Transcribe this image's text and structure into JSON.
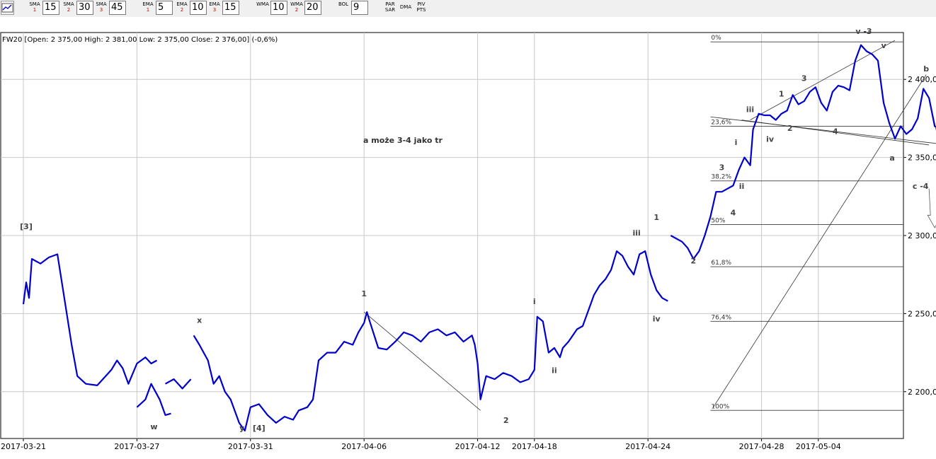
{
  "toolbar": {
    "indicators": [
      {
        "name": "SMA",
        "num": "1",
        "value": "15"
      },
      {
        "name": "SMA",
        "num": "2",
        "value": "30"
      },
      {
        "name": "SMA",
        "num": "3",
        "value": "45"
      },
      {
        "name": "EMA",
        "num": "1",
        "value": "5"
      },
      {
        "name": "EMA",
        "num": "2",
        "value": "10"
      },
      {
        "name": "EMA",
        "num": "3",
        "value": "15"
      },
      {
        "name": "WMA",
        "num": "",
        "value": "10"
      },
      {
        "name": "WMA",
        "num": "2",
        "value": "20"
      },
      {
        "name": "BOL",
        "num": "",
        "value": "9"
      }
    ],
    "buttons": [
      "PAR\nSAR",
      "DMA",
      "PIV\nPTS"
    ]
  },
  "chart_info": "FW20 [Open: 2 375,00  High: 2 381,00  Low: 2 375,00  Close: 2 376,00] (-0,6%)",
  "annotation_text": "a może 3-4  jako tr",
  "colors": {
    "price": "#0000cc",
    "grid": "#c8c8c8",
    "lines": "#000000"
  },
  "chart_data": {
    "type": "line",
    "ylim": [
      2170,
      2430
    ],
    "y_ticks": [
      "2 200,0",
      "2 250,0",
      "2 300,0",
      "2 350,0",
      "2 400,0"
    ],
    "y_tick_values": [
      2200,
      2250,
      2300,
      2350,
      2400
    ],
    "x_ticks": [
      "2017-03-21",
      "2017-03-27",
      "2017-03-31",
      "2017-04-06",
      "2017-04-12",
      "2017-04-18",
      "2017-04-24",
      "2017-04-28",
      "2017-05-04"
    ],
    "x_tick_index": [
      0,
      4,
      8,
      12,
      16,
      18,
      22,
      26,
      28
    ],
    "x_count": 31,
    "series": [
      {
        "values": [
          [
            0,
            2256
          ],
          [
            0.1,
            2270
          ],
          [
            0.2,
            2260
          ],
          [
            0.3,
            2285
          ],
          [
            0.6,
            2282
          ],
          [
            0.9,
            2286
          ],
          [
            1.2,
            2288
          ],
          [
            1.4,
            2265
          ],
          [
            1.7,
            2230
          ],
          [
            1.9,
            2210
          ],
          [
            2.2,
            2205
          ],
          [
            2.6,
            2204
          ],
          [
            2.9,
            2210
          ],
          [
            3.1,
            2214
          ],
          [
            3.3,
            2220
          ],
          [
            3.5,
            2215
          ],
          [
            3.7,
            2205
          ],
          [
            4.0,
            2218
          ],
          [
            4.3,
            2222
          ],
          [
            4.5,
            2218
          ],
          [
            4.7,
            2220
          ],
          null,
          [
            4.0,
            2190
          ],
          [
            4.3,
            2195
          ],
          [
            4.5,
            2205
          ],
          [
            4.8,
            2195
          ],
          [
            5.0,
            2185
          ],
          [
            5.2,
            2186
          ],
          null,
          [
            5.0,
            2205
          ],
          [
            5.3,
            2208
          ],
          [
            5.6,
            2202
          ],
          [
            5.9,
            2208
          ],
          null,
          [
            6.0,
            2236
          ],
          [
            6.2,
            2230
          ],
          [
            6.5,
            2220
          ],
          [
            6.7,
            2205
          ],
          [
            6.9,
            2210
          ],
          [
            7.1,
            2200
          ],
          [
            7.3,
            2195
          ],
          [
            7.5,
            2185
          ],
          [
            7.6,
            2180
          ],
          [
            7.8,
            2175
          ],
          [
            8.0,
            2190
          ],
          [
            8.3,
            2192
          ],
          [
            8.6,
            2185
          ],
          [
            8.9,
            2180
          ],
          [
            9.2,
            2184
          ],
          [
            9.5,
            2182
          ],
          [
            9.7,
            2188
          ],
          [
            10.0,
            2190
          ],
          [
            10.2,
            2195
          ],
          [
            10.4,
            2220
          ],
          [
            10.7,
            2225
          ],
          [
            11.0,
            2225
          ],
          [
            11.3,
            2232
          ],
          [
            11.6,
            2230
          ],
          [
            11.8,
            2238
          ],
          [
            12.0,
            2244
          ],
          [
            12.1,
            2251
          ],
          [
            12.2,
            2245
          ],
          [
            12.5,
            2228
          ],
          [
            12.8,
            2227
          ],
          [
            13.1,
            2232
          ],
          [
            13.4,
            2238
          ],
          [
            13.7,
            2236
          ],
          [
            14.0,
            2232
          ],
          [
            14.3,
            2238
          ],
          [
            14.6,
            2240
          ],
          [
            14.9,
            2236
          ],
          [
            15.2,
            2238
          ],
          [
            15.5,
            2232
          ],
          [
            15.8,
            2236
          ],
          [
            15.9,
            2230
          ],
          [
            16.0,
            2218
          ],
          [
            16.1,
            2195
          ],
          [
            16.3,
            2210
          ],
          [
            16.6,
            2208
          ],
          [
            16.9,
            2212
          ],
          [
            17.2,
            2210
          ],
          [
            17.5,
            2206
          ],
          [
            17.8,
            2208
          ],
          [
            18.0,
            2214
          ],
          [
            18.1,
            2248
          ],
          [
            18.3,
            2245
          ],
          [
            18.5,
            2225
          ],
          [
            18.7,
            2228
          ],
          [
            18.9,
            2222
          ],
          [
            19.0,
            2228
          ],
          [
            19.2,
            2232
          ],
          [
            19.5,
            2240
          ],
          [
            19.7,
            2242
          ],
          [
            19.9,
            2252
          ],
          [
            20.1,
            2262
          ],
          [
            20.3,
            2268
          ],
          [
            20.5,
            2272
          ],
          [
            20.7,
            2278
          ],
          [
            20.9,
            2290
          ],
          [
            21.1,
            2287
          ],
          [
            21.3,
            2280
          ],
          [
            21.5,
            2275
          ],
          [
            21.7,
            2288
          ],
          [
            21.9,
            2290
          ],
          [
            22.1,
            2275
          ],
          [
            22.3,
            2265
          ],
          [
            22.5,
            2260
          ],
          [
            22.7,
            2258
          ],
          null,
          [
            22.8,
            2300
          ],
          [
            23.0,
            2298
          ],
          [
            23.2,
            2296
          ],
          [
            23.4,
            2292
          ],
          [
            23.6,
            2285
          ],
          [
            23.8,
            2290
          ],
          [
            24.0,
            2300
          ],
          [
            24.2,
            2312
          ],
          [
            24.4,
            2328
          ],
          [
            24.6,
            2328
          ],
          [
            24.8,
            2330
          ],
          [
            25.0,
            2332
          ],
          [
            25.2,
            2342
          ],
          [
            25.4,
            2350
          ],
          [
            25.6,
            2345
          ],
          [
            25.7,
            2368
          ],
          [
            25.9,
            2378
          ],
          [
            26.1,
            2377
          ],
          [
            26.3,
            2377
          ],
          [
            26.5,
            2374
          ],
          [
            26.7,
            2378
          ],
          [
            26.9,
            2380
          ],
          [
            27.1,
            2390
          ],
          [
            27.3,
            2384
          ],
          [
            27.5,
            2386
          ],
          [
            27.7,
            2392
          ],
          [
            27.9,
            2395
          ],
          [
            28.1,
            2385
          ],
          [
            28.3,
            2380
          ],
          [
            28.5,
            2392
          ],
          [
            28.7,
            2396
          ],
          [
            28.9,
            2395
          ],
          [
            29.1,
            2393
          ],
          [
            29.3,
            2412
          ],
          [
            29.5,
            2422
          ],
          [
            29.7,
            2418
          ],
          [
            29.9,
            2416
          ],
          [
            30.1,
            2412
          ],
          [
            30.3,
            2385
          ],
          [
            30.5,
            2372
          ],
          [
            30.7,
            2362
          ],
          [
            30.9,
            2370
          ],
          [
            31.1,
            2365
          ],
          [
            31.3,
            2368
          ],
          [
            31.5,
            2375
          ],
          [
            31.7,
            2394
          ],
          [
            31.9,
            2388
          ],
          [
            32.1,
            2370
          ],
          [
            32.3,
            2368
          ]
        ]
      }
    ]
  },
  "fib_levels": [
    {
      "label": "0%",
      "value": 2424
    },
    {
      "label": "23,6%",
      "value": 2370
    },
    {
      "label": "38,2%",
      "value": 2335
    },
    {
      "label": "50%",
      "value": 2307
    },
    {
      "label": "61,8%",
      "value": 2280
    },
    {
      "label": "76,4%",
      "value": 2245
    },
    {
      "label": "100%",
      "value": 2188
    }
  ],
  "wave_labels": [
    {
      "text": "[3]",
      "x": 0.1,
      "y": 2304
    },
    {
      "text": "w",
      "x": 4.6,
      "y": 2176
    },
    {
      "text": "x",
      "x": 6.2,
      "y": 2244
    },
    {
      "text": "y",
      "x": 7.7,
      "y": 2175
    },
    {
      "text": "[4]",
      "x": 8.3,
      "y": 2175
    },
    {
      "text": "1",
      "x": 12.0,
      "y": 2261
    },
    {
      "text": "2",
      "x": 17.0,
      "y": 2180
    },
    {
      "text": "i",
      "x": 18.0,
      "y": 2256
    },
    {
      "text": "ii",
      "x": 18.7,
      "y": 2212
    },
    {
      "text": "iii",
      "x": 21.6,
      "y": 2300
    },
    {
      "text": "iv",
      "x": 22.3,
      "y": 2245
    },
    {
      "text": "1",
      "x": 22.3,
      "y": 2310
    },
    {
      "text": "2",
      "x": 23.6,
      "y": 2282
    },
    {
      "text": "3",
      "x": 24.6,
      "y": 2342
    },
    {
      "text": "4",
      "x": 25.0,
      "y": 2313
    },
    {
      "text": "i",
      "x": 25.1,
      "y": 2358
    },
    {
      "text": "ii",
      "x": 25.3,
      "y": 2330
    },
    {
      "text": "iii",
      "x": 25.6,
      "y": 2379
    },
    {
      "text": "iv",
      "x": 26.3,
      "y": 2360
    },
    {
      "text": "1",
      "x": 26.7,
      "y": 2389
    },
    {
      "text": "2",
      "x": 27.0,
      "y": 2367
    },
    {
      "text": "3",
      "x": 27.5,
      "y": 2399
    },
    {
      "text": "4",
      "x": 28.6,
      "y": 2365
    },
    {
      "text": "v -3",
      "x": 29.6,
      "y": 2429
    },
    {
      "text": "v",
      "x": 30.3,
      "y": 2420
    },
    {
      "text": "a",
      "x": 30.6,
      "y": 2348
    },
    {
      "text": "b",
      "x": 31.8,
      "y": 2405
    },
    {
      "text": "c -4",
      "x": 31.6,
      "y": 2330
    }
  ]
}
